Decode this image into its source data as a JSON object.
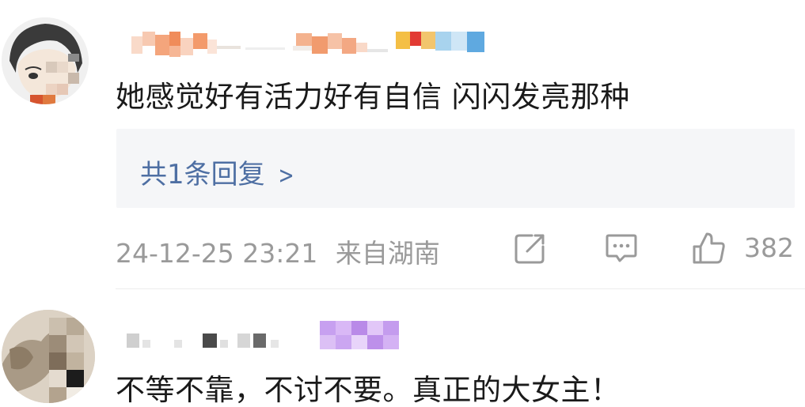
{
  "comments": [
    {
      "text": "她感觉好有活力好有自信 闪闪发亮那种",
      "replies_label": "共1条回复",
      "timestamp": "24-12-25 23:21",
      "location": "来自湖南",
      "likes": "382"
    },
    {
      "text": "不等不靠，不讨不要。真正的大女主！"
    }
  ],
  "icons": {
    "share": "share-icon",
    "comment": "comment-icon",
    "like": "like-icon",
    "chevron": "chevron-right-icon"
  },
  "colors": {
    "link": "#4e6fa3",
    "meta": "#9a9a9a",
    "text": "#1a1a1a",
    "reply_bg": "#f5f6f8"
  }
}
